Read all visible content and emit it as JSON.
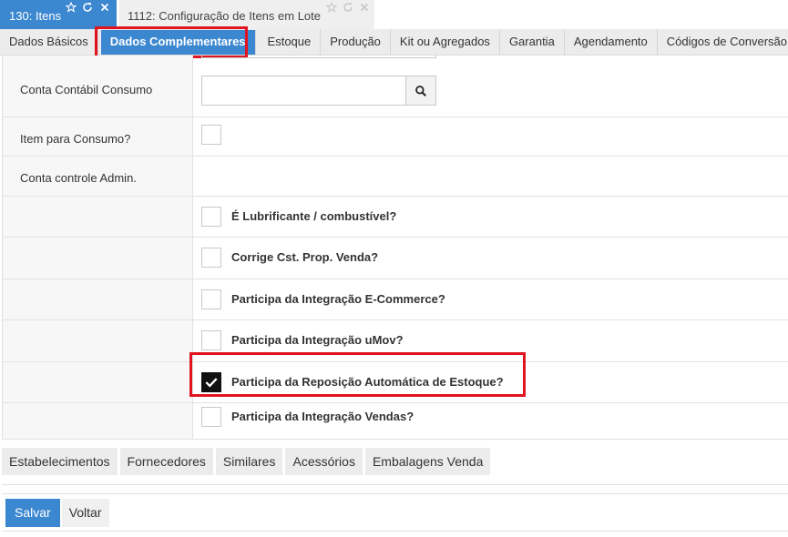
{
  "window_tabs": [
    {
      "label": "130: Itens",
      "active": true
    },
    {
      "label": "1112: Configuração de Itens em Lote",
      "active": false
    }
  ],
  "tab_icons": [
    "star-icon",
    "refresh-icon",
    "close-icon"
  ],
  "sub_tabs": [
    {
      "label": "Dados Básicos"
    },
    {
      "label": "Dados Complementares",
      "active": true
    },
    {
      "label": "Estoque"
    },
    {
      "label": "Produção"
    },
    {
      "label": "Kit ou Agregados"
    },
    {
      "label": "Garantia"
    },
    {
      "label": "Agendamento"
    },
    {
      "label": "Códigos de Conversão"
    }
  ],
  "form": {
    "conta_contabil_consumo": {
      "label": "Conta Contábil Consumo",
      "value": ""
    },
    "item_para_consumo": {
      "label": "Item para Consumo?",
      "checked": false
    },
    "conta_controle_admin": {
      "label": "Conta controle Admin."
    },
    "checkboxes": [
      {
        "label": "É Lubrificante / combustível?",
        "checked": false
      },
      {
        "label": "Corrige Cst. Prop. Venda?",
        "checked": false
      },
      {
        "label": "Participa da Integração E-Commerce?",
        "checked": false
      },
      {
        "label": "Participa da Integração uMov?",
        "checked": false
      },
      {
        "label": "Participa da Reposição Automática de Estoque?",
        "checked": true
      },
      {
        "label": "Participa da Integração Vendas?",
        "checked": false
      }
    ]
  },
  "bottom_tabs": [
    "Estabelecimentos",
    "Fornecedores",
    "Similares",
    "Acessórios",
    "Embalagens Venda"
  ],
  "actions": {
    "save": "Salvar",
    "back": "Voltar"
  },
  "colors": {
    "accent": "#3b87d0",
    "highlight": "#e0141e"
  }
}
